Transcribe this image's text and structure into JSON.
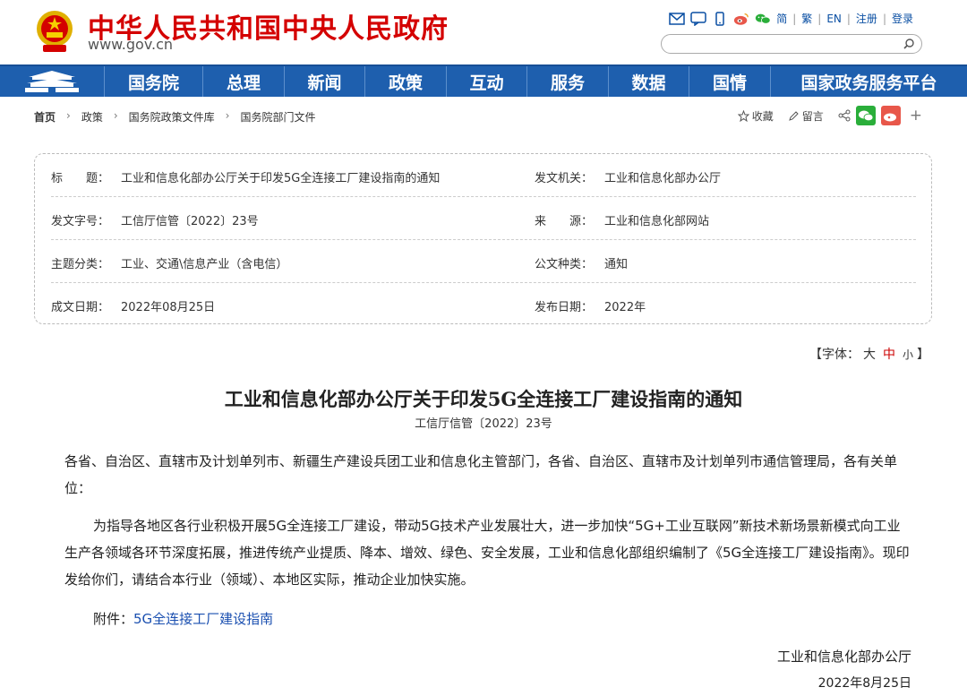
{
  "header": {
    "site_title": "中华人民共和国中央人民政府",
    "site_url": "www.gov.cn",
    "links": {
      "simplified": "简",
      "traditional": "繁",
      "english": "EN",
      "register": "注册",
      "login": "登录"
    },
    "search": {
      "placeholder": ""
    }
  },
  "nav": {
    "items": [
      "国务院",
      "总理",
      "新闻",
      "政策",
      "互动",
      "服务",
      "数据",
      "国情",
      "国家政务服务平台"
    ]
  },
  "breadcrumb": [
    "首页",
    "政策",
    "国务院政策文件库",
    "国务院部门文件"
  ],
  "tools": {
    "favorite": "收藏",
    "comment": "留言"
  },
  "info": {
    "title_label": "标　　题：",
    "title_value": "工业和信息化部办公厅关于印发5G全连接工厂建设指南的通知",
    "issuer_label": "发文机关：",
    "issuer_value": "工业和信息化部办公厅",
    "docno_label": "发文字号：",
    "docno_value": "工信厅信管〔2022〕23号",
    "source_label": "来　　源：",
    "source_value": "工业和信息化部网站",
    "topic_label": "主题分类：",
    "topic_value": "工业、交通\\信息产业（含电信）",
    "type_label": "公文种类：",
    "type_value": "通知",
    "written_label": "成文日期：",
    "written_value": "2022年08月25日",
    "published_label": "发布日期：",
    "published_value": "2022年"
  },
  "fontsize": {
    "prefix": "【字体：",
    "large": "大",
    "medium": "中",
    "small": "小",
    "suffix": "】"
  },
  "article": {
    "title": "工业和信息化部办公厅关于印发5G全连接工厂建设指南的通知",
    "docno": "工信厅信管〔2022〕23号",
    "para1": "各省、自治区、直辖市及计划单列市、新疆生产建设兵团工业和信息化主管部门，各省、自治区、直辖市及计划单列市通信管理局，各有关单位：",
    "para2": "为指导各地区各行业积极开展5G全连接工厂建设，带动5G技术产业发展壮大，进一步加快“5G+工业互联网”新技术新场景新模式向工业生产各领域各环节深度拓展，推进传统产业提质、降本、增效、绿色、安全发展，工业和信息化部组织编制了《5G全连接工厂建设指南》。现印发给你们，请结合本行业（领域）、本地区实际，推动企业加快实施。",
    "attach_label": "附件：",
    "attach_link": "5G全连接工厂建设指南",
    "signature": "工业和信息化部办公厅",
    "date": "2022年8月25日"
  },
  "colors": {
    "brand_red": "#d40000",
    "nav_blue": "#1e5fae",
    "link_blue": "#1a4fb0",
    "wechat_green": "#2aae3a",
    "weibo_red": "#e8574a"
  }
}
